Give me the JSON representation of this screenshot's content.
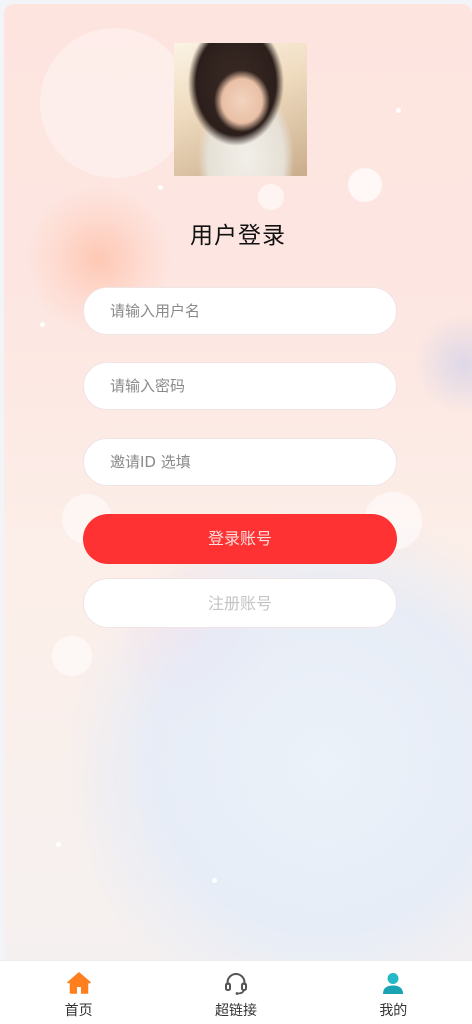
{
  "login": {
    "title": "用户登录",
    "username_placeholder": "请输入用户名",
    "password_placeholder": "请输入密码",
    "invite_placeholder": "邀请ID 选填",
    "login_button": "登录账号",
    "register_button": "注册账号"
  },
  "tabbar": {
    "items": [
      {
        "label": "首页",
        "icon": "home-icon",
        "color": "#ff7f1e"
      },
      {
        "label": "超链接",
        "icon": "headset-icon",
        "color": "#555555"
      },
      {
        "label": "我的",
        "icon": "user-icon",
        "color": "#26b8c6"
      }
    ]
  },
  "colors": {
    "primary": "#fe3233",
    "background": "#fde4df"
  }
}
